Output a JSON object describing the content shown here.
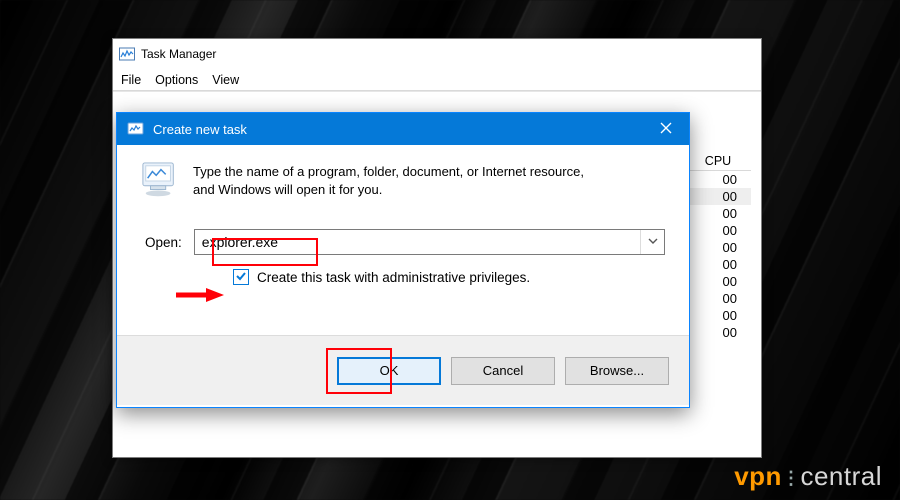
{
  "taskManager": {
    "title": "Task Manager",
    "menu": {
      "file": "File",
      "options": "Options",
      "view": "View"
    },
    "cpuHeader": "CPU",
    "cpuValues": [
      "00",
      "00",
      "00",
      "00",
      "00",
      "00",
      "00",
      "00",
      "00",
      "00"
    ]
  },
  "dialog": {
    "title": "Create new task",
    "description": "Type the name of a program, folder, document, or Internet resource, and Windows will open it for you.",
    "openLabel": "Open:",
    "openValue": "explorer.exe",
    "adminCheck": "Create this task with administrative privileges.",
    "adminChecked": true,
    "buttons": {
      "ok": "OK",
      "cancel": "Cancel",
      "browse": "Browse..."
    }
  },
  "watermark": {
    "left": "vpn",
    "right": "central"
  }
}
